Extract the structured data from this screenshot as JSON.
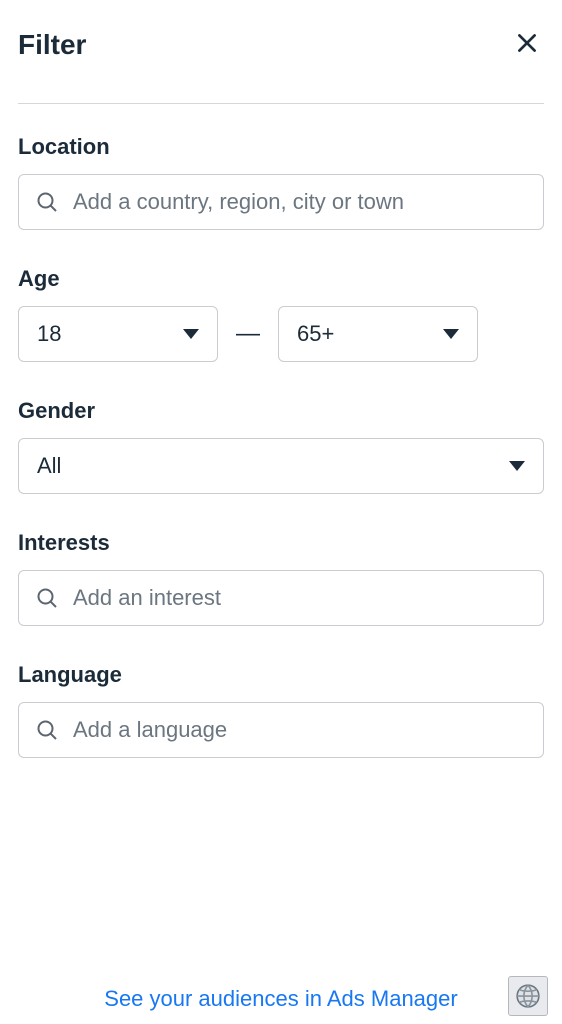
{
  "header": {
    "title": "Filter"
  },
  "location": {
    "label": "Location",
    "placeholder": "Add a country, region, city or town"
  },
  "age": {
    "label": "Age",
    "min": "18",
    "max": "65+",
    "separator": "—"
  },
  "gender": {
    "label": "Gender",
    "value": "All"
  },
  "interests": {
    "label": "Interests",
    "placeholder": "Add an interest"
  },
  "language": {
    "label": "Language",
    "placeholder": "Add a language"
  },
  "footer": {
    "link_text": "See your audiences in Ads Manager"
  }
}
